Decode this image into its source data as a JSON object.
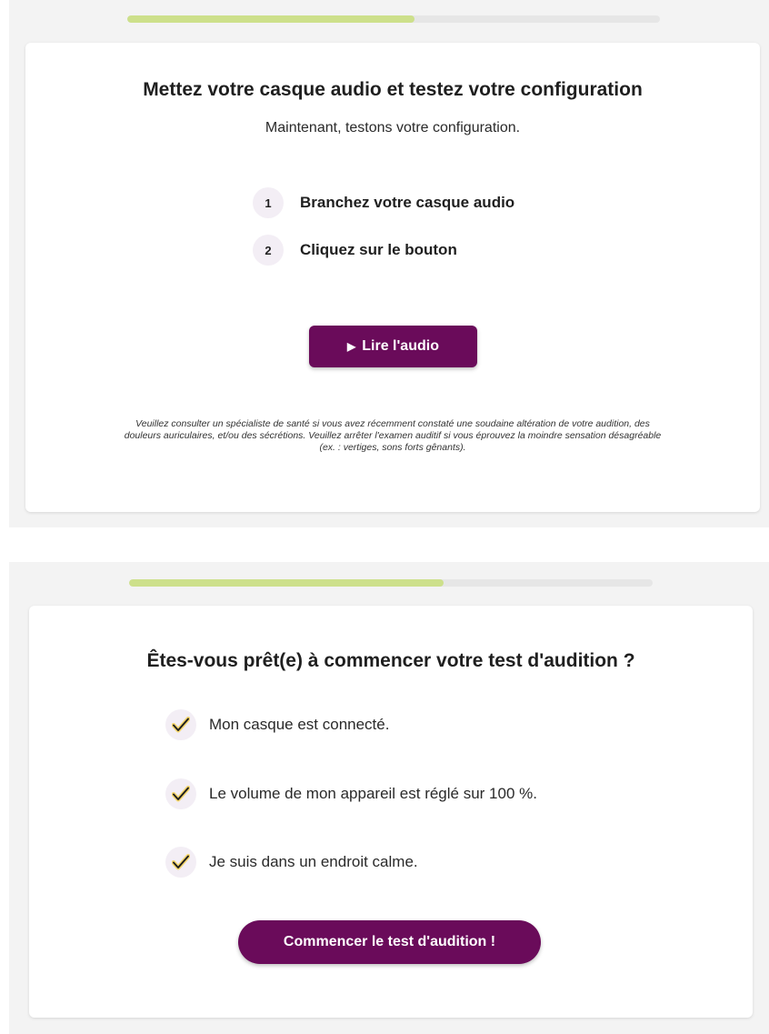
{
  "screen1": {
    "progress": 0.54,
    "title": "Mettez votre casque audio et testez votre configuration",
    "subtitle": "Maintenant, testons votre configuration.",
    "steps": [
      {
        "number": "1",
        "label": "Branchez votre casque audio"
      },
      {
        "number": "2",
        "label": "Cliquez sur le bouton"
      }
    ],
    "play_button": {
      "icon": "play-icon",
      "label": "Lire l'audio"
    },
    "disclaimer": "Veuillez consulter un spécialiste de santé si vous avez récemment constaté une soudaine altération de votre audition, des douleurs auriculaires, et/ou des sécrétions. Veuillez arrêter l'examen auditif si vous éprouvez la moindre sensation désagréable (ex. : vertiges, sons forts gênants)."
  },
  "screen2": {
    "progress": 0.6,
    "title": "Êtes-vous prêt(e) à commencer votre test d'audition ?",
    "checklist": [
      {
        "icon": "check-icon",
        "label": "Mon casque est connecté."
      },
      {
        "icon": "check-icon",
        "label": "Le volume de mon appareil est réglé sur 100 %."
      },
      {
        "icon": "check-icon",
        "label": "Je suis dans un endroit calme."
      }
    ],
    "start_button": {
      "label": "Commencer le test d'audition !"
    }
  },
  "colors": {
    "accent": "#6a0b5a",
    "progress_fill": "#cde08b",
    "progress_track": "#e6e6e6",
    "badge_bg": "#f3eef5",
    "check_stroke": "#1f1f1f",
    "check_fill": "#f5d76e"
  }
}
